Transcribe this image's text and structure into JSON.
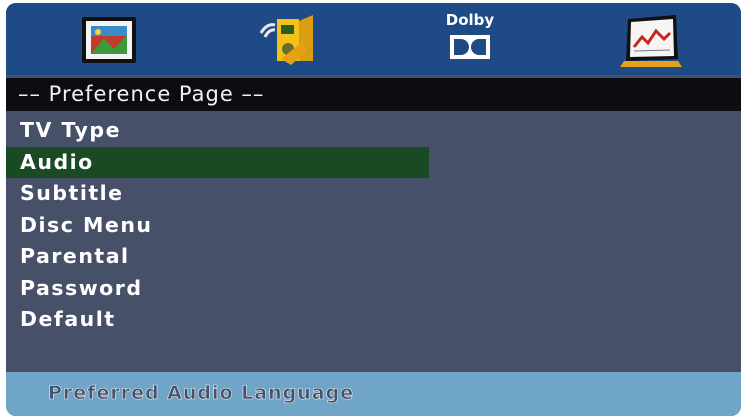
{
  "toolbar": {
    "icons": [
      {
        "name": "tv-display-icon"
      },
      {
        "name": "audio-speaker-icon"
      },
      {
        "name": "dolby-digital-icon",
        "label": "Dolby"
      },
      {
        "name": "preference-graph-icon"
      }
    ]
  },
  "header": {
    "title": "–– Preference Page ––"
  },
  "menu": {
    "items": [
      {
        "label": "TV Type"
      },
      {
        "label": "Audio"
      },
      {
        "label": "Subtitle"
      },
      {
        "label": "Disc Menu"
      },
      {
        "label": "Parental"
      },
      {
        "label": "Password"
      },
      {
        "label": "Default"
      }
    ],
    "selected_index": 1
  },
  "status": {
    "text": "Preferred Audio Language"
  },
  "colors": {
    "background": "#465068",
    "icon_bar": "#1e4a86",
    "header": "#0c0d11",
    "selection": "#194a23",
    "status_bar": "#6fa5c6"
  }
}
